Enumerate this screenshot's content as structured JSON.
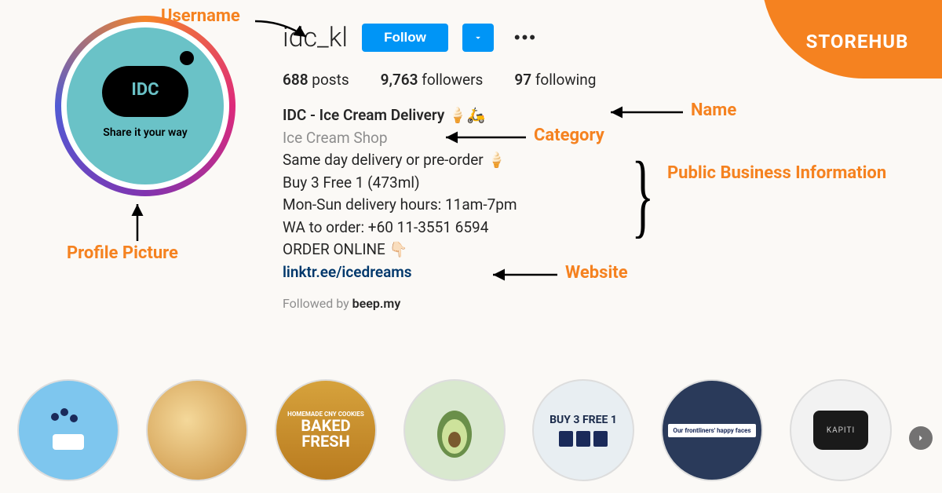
{
  "brand": {
    "name": "STOREHUB"
  },
  "profile": {
    "username": "idc_kl",
    "avatar": {
      "label": "IDC",
      "tagline": "Share it your way"
    },
    "follow_label": "Follow"
  },
  "stats": {
    "posts_count": "688",
    "posts_label": "posts",
    "followers_count": "9,763",
    "followers_label": "followers",
    "following_count": "97",
    "following_label": "following"
  },
  "bio": {
    "display_name": "IDC - Ice Cream Delivery 🍦🛵",
    "category": "Ice Cream Shop",
    "line1": "Same day delivery or pre-order 🍦",
    "line2": "Buy 3 Free 1 (473ml)",
    "line3": "Mon-Sun delivery hours: 11am-7pm",
    "line4": "WA to order: +60 11-3551 6594",
    "line5": "ORDER ONLINE 👇🏻",
    "website": "linktr.ee/icedreams",
    "followed_by_prefix": "Followed by ",
    "followed_by_name": "beep.my"
  },
  "annotations": {
    "username": "Username",
    "profile_picture": "Profile Picture",
    "name": "Name",
    "category": "Category",
    "public_info": "Public Business Information",
    "website": "Website"
  },
  "highlights": {
    "h3_top": "HOMEMADE CNY COOKIES",
    "h3_main": "BAKED FRESH",
    "h5": "BUY 3 FREE 1",
    "h6": "Our frontliners' happy faces",
    "h7": "KAPITI"
  }
}
